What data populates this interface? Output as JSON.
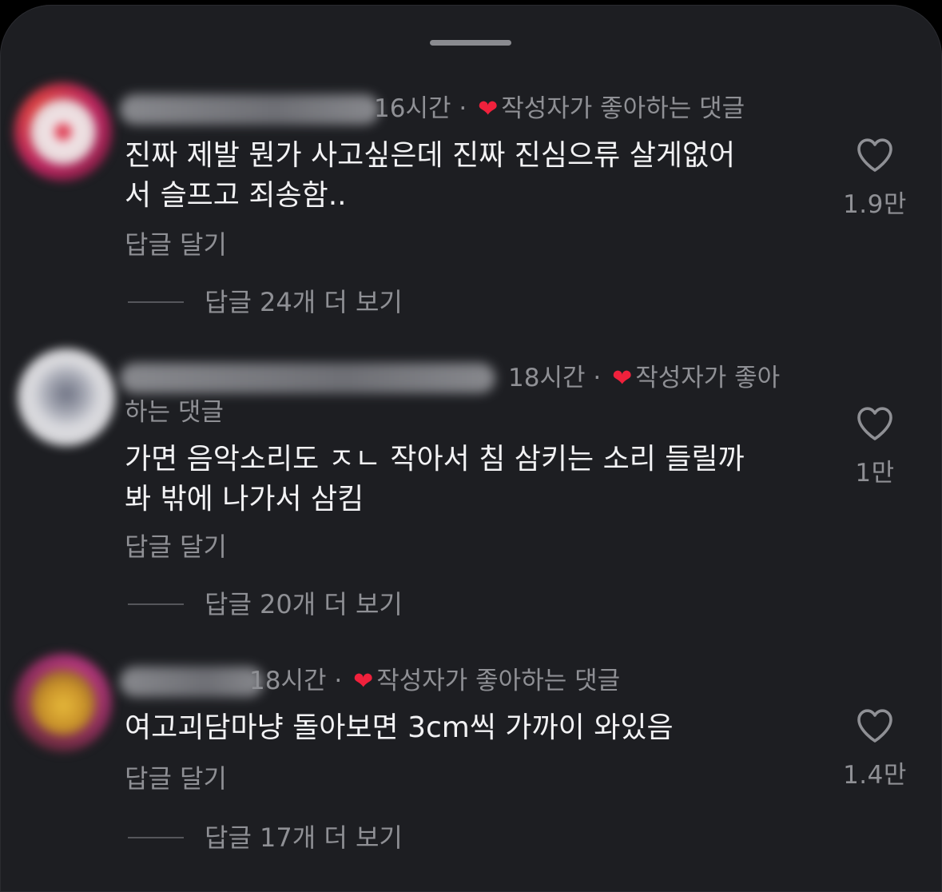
{
  "comments": [
    {
      "username": "",
      "time": "16시간",
      "separator": "·",
      "creator_liked": "작성자가 좋아하는 댓글",
      "text_line1": "진짜 제발 뭔가 사고싶은데 진짜 진심으류 살게없어",
      "text_line2": "서 슬프고 죄송함..",
      "reply_label": "답글 달기",
      "view_replies": "답글 24개 더 보기",
      "likes": "1.9만"
    },
    {
      "username": "",
      "time": "18시간",
      "separator": "·",
      "creator_liked_part1": "작성자가 좋아",
      "creator_liked_part2": "하는 댓글",
      "text_line1": "가면 음악소리도 ㅈㄴ 작아서 침 삼키는 소리 들릴까",
      "text_line2": "봐 밖에 나가서 삼킴",
      "reply_label": "답글 달기",
      "view_replies": "답글 20개 더 보기",
      "likes": "1만"
    },
    {
      "username": "",
      "time": "18시간",
      "separator": "·",
      "creator_liked": "작성자가 좋아하는 댓글",
      "text_line1": "여고괴담마냥 돌아보면 3cm씩 가까이 와있음",
      "reply_label": "답글 달기",
      "view_replies": "답글 17개 더 보기",
      "likes": "1.4만"
    }
  ],
  "icons": {
    "like": "heart-outline-icon",
    "creator_heart": "heart-filled-icon"
  },
  "colors": {
    "background": "#1d1e22",
    "text": "#f2f2f4",
    "muted": "#8f9095",
    "heart": "#f0213c"
  }
}
